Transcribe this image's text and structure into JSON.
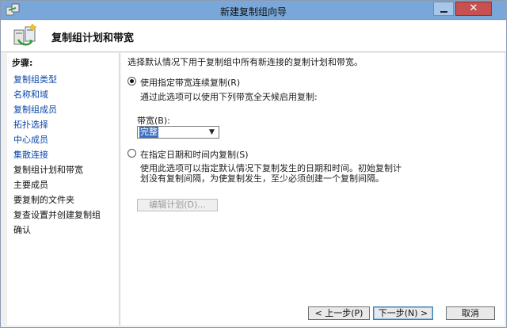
{
  "window": {
    "title": "新建复制组向导",
    "close_glyph": "✕"
  },
  "header": {
    "title": "复制组计划和带宽"
  },
  "sidebar": {
    "heading": "步骤:",
    "steps": [
      {
        "label": "复制组类型",
        "state": "done"
      },
      {
        "label": "名称和域",
        "state": "done"
      },
      {
        "label": "复制组成员",
        "state": "done"
      },
      {
        "label": "拓扑选择",
        "state": "done"
      },
      {
        "label": "中心成员",
        "state": "done"
      },
      {
        "label": "集散连接",
        "state": "done"
      },
      {
        "label": "复制组计划和带宽",
        "state": "current"
      },
      {
        "label": "主要成员",
        "state": "future"
      },
      {
        "label": "要复制的文件夹",
        "state": "future"
      },
      {
        "label": "复查设置并创建复制组",
        "state": "future"
      },
      {
        "label": "确认",
        "state": "future"
      }
    ]
  },
  "content": {
    "description": "选择默认情况下用于复制组中所有新连接的复制计划和带宽。",
    "option_continuous": {
      "label": "使用指定带宽连续复制(R)",
      "checked": true,
      "subtext": "通过此选项可以使用下列带宽全天候启用复制:"
    },
    "bandwidth": {
      "label": "带宽(B):",
      "selected": "完整"
    },
    "option_schedule": {
      "label": "在指定日期和时间内复制(S)",
      "checked": false,
      "subtext_line1": "使用此选项可以指定默认情况下复制发生的日期和时间。初始复制计",
      "subtext_line2": "划没有复制间隔，为使复制发生，至少必须创建一个复制间隔。"
    },
    "edit_schedule_button": "编辑计划(D)..."
  },
  "footer": {
    "back_label": "< 上一步(P)",
    "next_label": "下一步(N) >",
    "cancel_label": "取消"
  }
}
